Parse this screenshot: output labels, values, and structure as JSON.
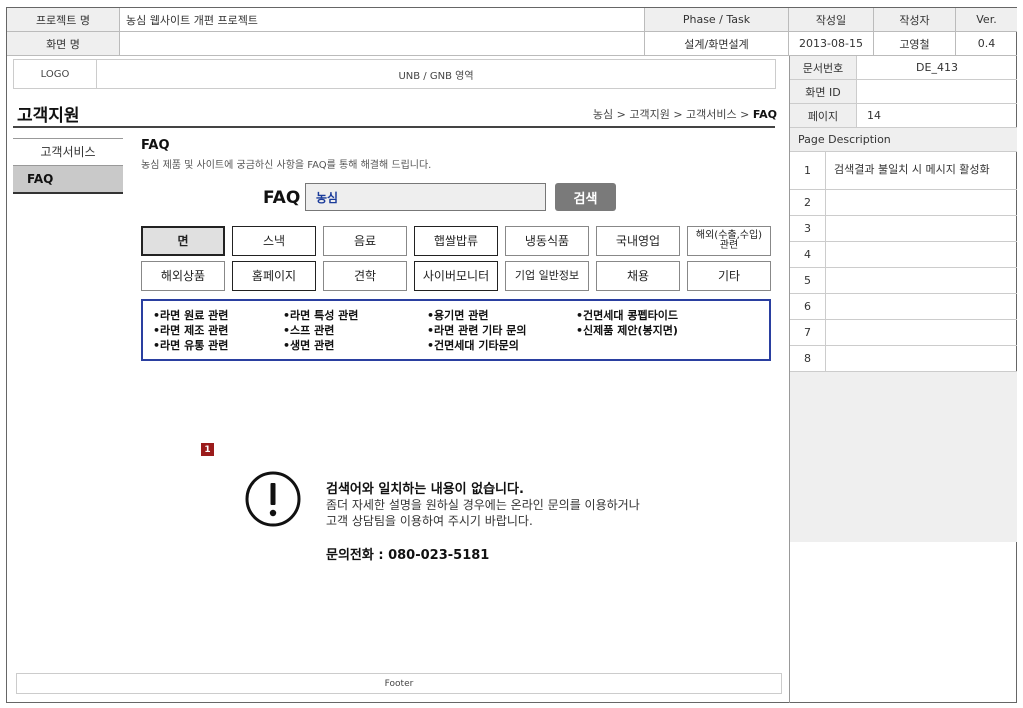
{
  "header": {
    "project_label": "프로젝트 명",
    "project_value": "농심 웹사이트 개편 프로젝트",
    "screen_label": "화면 명",
    "screen_value": "",
    "phase_label": "Phase / Task",
    "phase_value": "설계/화면설계",
    "date_label": "작성일",
    "date_value": "2013-08-15",
    "author_label": "작성자",
    "author_value": "고영철",
    "ver_label": "Ver.",
    "ver_value": "0.4"
  },
  "right_panel": {
    "doc_no_label": "문서번호",
    "doc_no_value": "DE_413",
    "screen_id_label": "화면 ID",
    "screen_id_value": "",
    "page_label": "페이지",
    "page_value": "14",
    "desc_title": "Page Description",
    "rows": [
      {
        "num": "1",
        "text": "검색결과 불일치 시 메시지 활성화"
      },
      {
        "num": "2",
        "text": ""
      },
      {
        "num": "3",
        "text": ""
      },
      {
        "num": "4",
        "text": ""
      },
      {
        "num": "5",
        "text": ""
      },
      {
        "num": "6",
        "text": ""
      },
      {
        "num": "7",
        "text": ""
      },
      {
        "num": "8",
        "text": ""
      }
    ]
  },
  "gnb": {
    "logo": "LOGO",
    "unb": "UNB / GNB 영역"
  },
  "page": {
    "title": "고객지원",
    "breadcrumb_prefix": "농심 > 고객지원 > 고객서비스 > ",
    "breadcrumb_current": "FAQ"
  },
  "lnb": {
    "item1": "고객서비스",
    "item2": "FAQ"
  },
  "faq": {
    "heading": "FAQ",
    "subtitle": "농심 제품 및 사이트에 궁금하신 사항을 FAQ를 통해 해결해 드립니다.",
    "search_label": "FAQ",
    "search_value": "농심",
    "search_button": "검색"
  },
  "categories": {
    "r1": [
      "면",
      "스낵",
      "음료",
      "햅쌀밥류",
      "냉동식품",
      "국내영업",
      "해외(수출,수입)\n관련"
    ],
    "r2": [
      "해외상품",
      "홈페이지",
      "견학",
      "사이버모니터",
      "기업 일반정보",
      "채용",
      "기타"
    ]
  },
  "topics": {
    "c1": [
      "•라면 원료 관련",
      "•라면 제조 관련",
      "•라면 유통 관련"
    ],
    "c2": [
      "•라면 특성 관련",
      "•스프 관련",
      "•생면 관련"
    ],
    "c3": [
      "•용기면 관련",
      "•라면 관련 기타 문의",
      "•건면세대 기타문의"
    ],
    "c4": [
      "•건면세대 콩펩타이드",
      "•신제품 제안(봉지면)"
    ]
  },
  "message": {
    "badge": "1",
    "title": "검색어와 일치하는 내용이 없습니다.",
    "line1": "좀더 자세한 설명을 원하실 경우에는 온라인 문의를 이용하거나",
    "line2": "고객 상담팀을 이용하여 주시기 바랍니다.",
    "phone": "문의전화 : 080-023-5181"
  },
  "footer": "Footer",
  "colors": {
    "accent_border": "#2a3fa0",
    "search_text": "#1a3b9a",
    "badge": "#9b1b1b",
    "selected_lnb": "#c9c9c9"
  }
}
